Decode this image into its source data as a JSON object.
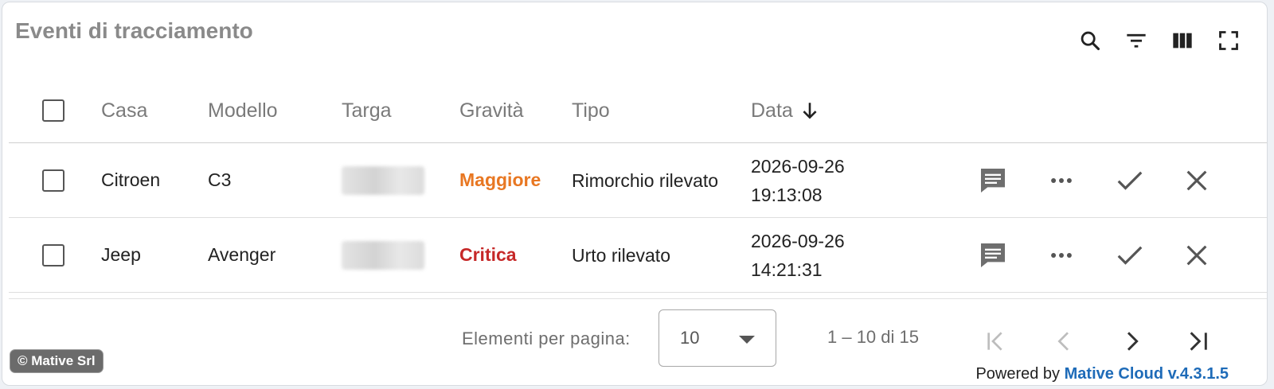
{
  "title": "Eventi di tracciamento",
  "toolbar": {
    "icons": [
      "search-icon",
      "filter-icon",
      "columns-icon",
      "fullscreen-icon"
    ]
  },
  "table": {
    "headers": {
      "casa": "Casa",
      "modello": "Modello",
      "targa": "Targa",
      "gravita": "Gravità",
      "tipo": "Tipo",
      "data": "Data"
    },
    "sort_icon": "arrow-down-icon",
    "rows": [
      {
        "casa": "Citroen",
        "modello": "C3",
        "targa": "",
        "gravita": "Maggiore",
        "gravita_color": "#e87722",
        "tipo": "Rimorchio rilevato",
        "data_date": "2026-09-26",
        "data_time": "19:13:08"
      },
      {
        "casa": "Jeep",
        "modello": "Avenger",
        "targa": "",
        "gravita": "Critica",
        "gravita_color": "#c62828",
        "tipo": "Urto rilevato",
        "data_date": "2026-09-26",
        "data_time": "14:21:31"
      }
    ],
    "row_actions": [
      "comment-icon",
      "more-icon",
      "check-icon",
      "close-icon"
    ]
  },
  "pagination": {
    "label": "Elementi per pagina:",
    "page_size": "10",
    "range": "1 – 10 di 15",
    "nav_icons": [
      "first-page-icon",
      "prev-page-icon",
      "next-page-icon",
      "last-page-icon"
    ]
  },
  "footer": {
    "copyright": "© Mative Srl",
    "powered_prefix": "Powered by",
    "powered_brand": "Mative Cloud v.4.3.1.5"
  }
}
